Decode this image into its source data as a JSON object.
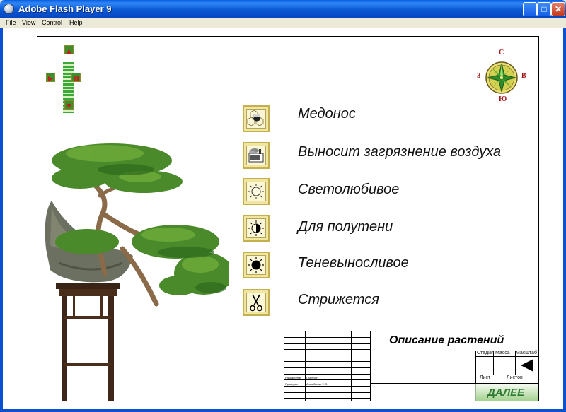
{
  "window": {
    "title": "Adobe Flash Player 9",
    "controls": {
      "minimize": "_",
      "maximize": "□",
      "close": "✕"
    }
  },
  "menu": [
    "File",
    "View",
    "Control",
    "Help"
  ],
  "compass": {
    "north": "С",
    "south": "Ю",
    "west": "З",
    "east": "В"
  },
  "properties": [
    {
      "label": "Медонос",
      "icon": "bee-honeycomb-icon"
    },
    {
      "label": "Выносит загрязнение воздуха",
      "icon": "factory-icon"
    },
    {
      "label": "Светолюбивое",
      "icon": "sun-icon"
    },
    {
      "label": "Для полутени",
      "icon": "half-sun-icon"
    },
    {
      "label": "Теневыносливое",
      "icon": "dark-sun-icon"
    },
    {
      "label": "Стрижется",
      "icon": "scissors-icon"
    }
  ],
  "stamp": {
    "title": "Описание растений",
    "col_stage": "Стадия",
    "col_mass": "Масса",
    "col_scale": "Масштаб",
    "sheet": "Лист",
    "sheets": "Листов",
    "developed_label": "Разработал",
    "developed_name": "Гладуй Н.",
    "checked_label": "Проверил",
    "checked_name": "Алимбаева Ф.В.",
    "next_button": "ДАЛЕЕ"
  },
  "colors": {
    "accent_green": "#3e8f2a",
    "title_blue": "#0a58d4",
    "icon_tile": "#f0e6a0",
    "compass_label": "#a01818"
  }
}
